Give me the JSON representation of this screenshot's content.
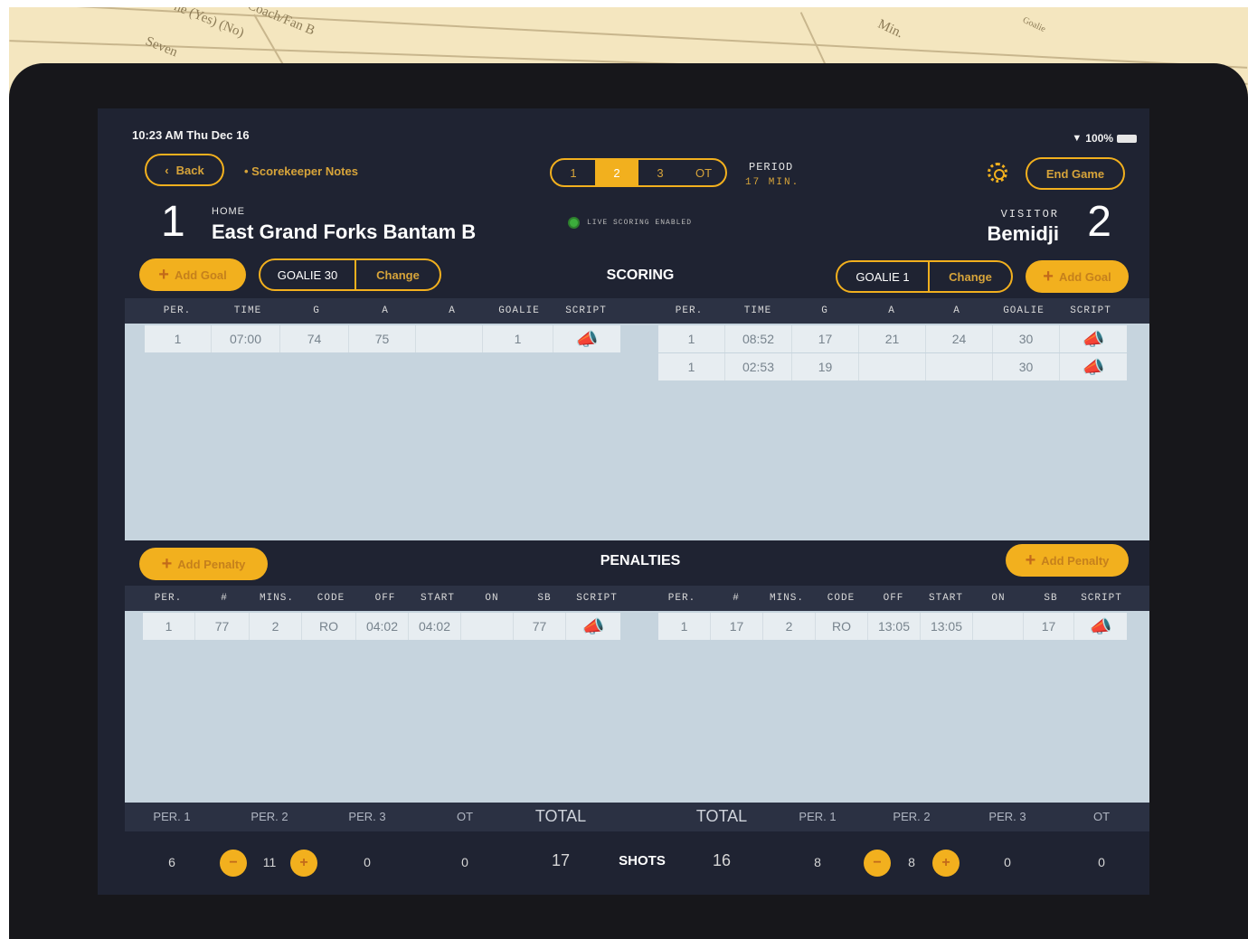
{
  "paper": {
    "texts": [
      "ne (Yes) (No)",
      "ule Coach/Fan B",
      "Seven",
      "Min.",
      "Goalie"
    ]
  },
  "status": {
    "time": "10:23 AM   Thu Dec 16",
    "battery": "100%"
  },
  "nav": {
    "back_label": "Back",
    "notes_label": "• Scorekeeper Notes",
    "end_game_label": "End Game"
  },
  "period": {
    "segments": [
      "1",
      "2",
      "3",
      "OT"
    ],
    "active_index": 1,
    "label": "PERIOD",
    "minutes": "17 MIN."
  },
  "home": {
    "tag": "HOME",
    "name": "East Grand Forks Bantam B",
    "score": "1"
  },
  "visitor": {
    "tag": "VISITOR",
    "name": "Bemidji",
    "score": "2"
  },
  "live_scoring": "LIVE SCORING ENABLED",
  "scoring": {
    "title": "SCORING",
    "add_goal_label": "Add Goal",
    "home_goalie": {
      "label": "GOALIE 30",
      "change": "Change"
    },
    "visitor_goalie": {
      "label": "GOALIE 1",
      "change": "Change"
    },
    "headers_home": [
      "PER.",
      "TIME",
      "G",
      "A",
      "A",
      "GOALIE",
      "SCRIPT"
    ],
    "headers_visitor": [
      "PER.",
      "TIME",
      "G",
      "A",
      "A",
      "GOALIE",
      "SCRIPT"
    ],
    "home_rows": [
      {
        "per": "1",
        "time": "07:00",
        "g": "74",
        "a1": "75",
        "a2": "",
        "goalie": "1"
      }
    ],
    "visitor_rows": [
      {
        "per": "1",
        "time": "08:52",
        "g": "17",
        "a1": "21",
        "a2": "24",
        "goalie": "30"
      },
      {
        "per": "1",
        "time": "02:53",
        "g": "19",
        "a1": "",
        "a2": "",
        "goalie": "30"
      }
    ]
  },
  "penalties": {
    "title": "PENALTIES",
    "add_label": "Add Penalty",
    "headers_home": [
      "PER.",
      "#",
      "MINS.",
      "CODE",
      "OFF",
      "START",
      "ON",
      "SB",
      "SCRIPT"
    ],
    "headers_visitor": [
      "PER.",
      "#",
      "MINS.",
      "CODE",
      "OFF",
      "START",
      "ON",
      "SB",
      "SCRIPT"
    ],
    "home_rows": [
      {
        "per": "1",
        "num": "77",
        "mins": "2",
        "code": "RO",
        "off": "04:02",
        "start": "04:02",
        "on": "",
        "sb": "77"
      }
    ],
    "visitor_rows": [
      {
        "per": "1",
        "num": "17",
        "mins": "2",
        "code": "RO",
        "off": "13:05",
        "start": "13:05",
        "on": "",
        "sb": "17"
      }
    ]
  },
  "shots": {
    "label": "SHOTS",
    "home_headers": [
      "PER. 1",
      "PER. 2",
      "PER. 3",
      "OT",
      "TOTAL"
    ],
    "visitor_headers": [
      "TOTAL",
      "PER. 1",
      "PER. 2",
      "PER. 3",
      "OT"
    ],
    "home_values": [
      "6",
      "11",
      "0",
      "0",
      "17"
    ],
    "visitor_values": [
      "16",
      "8",
      "8",
      "0",
      "0"
    ],
    "minus": "−",
    "plus": "+"
  },
  "colors": {
    "accent": "#f2b01e",
    "screen_bg": "#1f2332",
    "table_bg": "#c6d4de"
  }
}
